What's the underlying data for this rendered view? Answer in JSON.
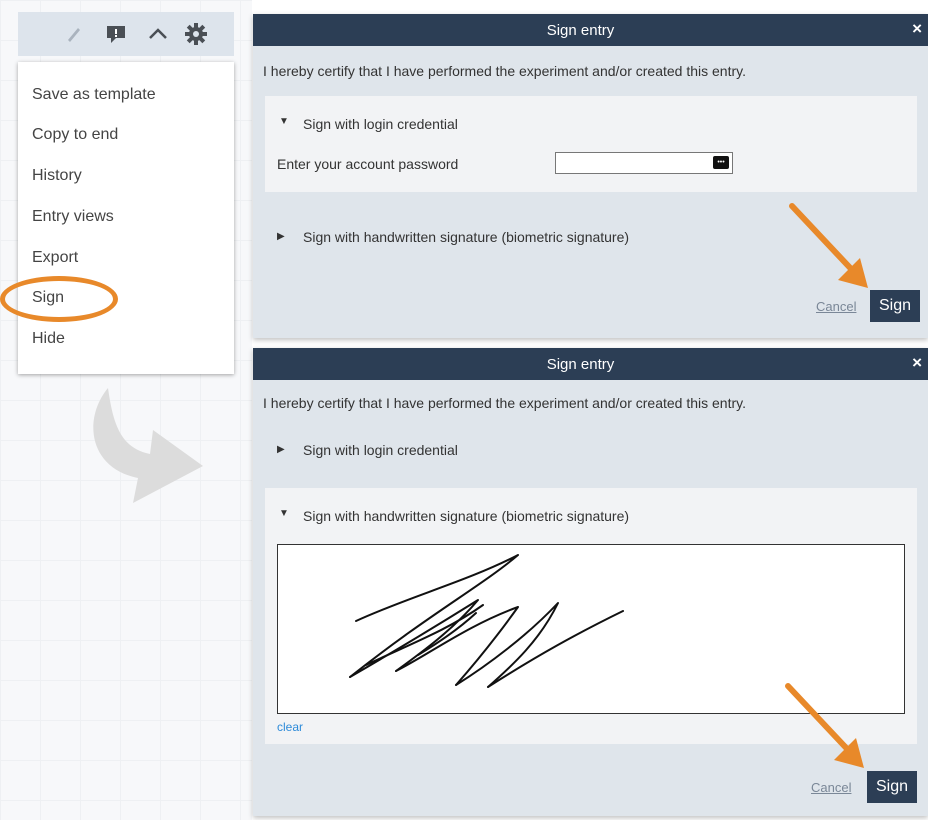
{
  "menu": {
    "items": [
      {
        "label": "Save as template"
      },
      {
        "label": "Copy to end"
      },
      {
        "label": "History"
      },
      {
        "label": "Entry views"
      },
      {
        "label": "Export"
      },
      {
        "label": "Sign"
      },
      {
        "label": "Hide"
      }
    ],
    "highlighted": "Sign"
  },
  "toolbar": {
    "icons": [
      "pencil-icon",
      "comment-icon",
      "chevron-up-icon",
      "gear-icon"
    ]
  },
  "dialog1": {
    "title": "Sign entry",
    "close": "×",
    "certification": "I hereby certify that I have performed the experiment and/or created this entry.",
    "login_section": {
      "label": "Sign with login credential",
      "expanded": true,
      "password_label": "Enter your account password",
      "password_value": "",
      "key_badge": "•••"
    },
    "handwritten_section": {
      "label": "Sign with handwritten signature (biometric signature)",
      "expanded": false
    },
    "cancel": "Cancel",
    "sign": "Sign"
  },
  "dialog2": {
    "title": "Sign entry",
    "close": "×",
    "certification": "I hereby certify that I have performed the experiment and/or created this entry.",
    "login_section": {
      "label": "Sign with login credential",
      "expanded": false
    },
    "handwritten_section": {
      "label": "Sign with handwritten signature (biometric signature)",
      "expanded": true,
      "clear": "clear"
    },
    "cancel": "Cancel",
    "sign": "Sign"
  },
  "colors": {
    "header": "#2c3e55",
    "dialog_body": "#dfe5eb",
    "accent_orange": "#e8892a",
    "link_blue": "#2e8bd9"
  }
}
